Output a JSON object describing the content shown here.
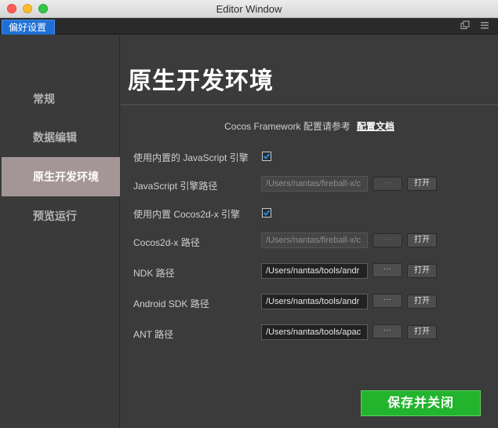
{
  "window": {
    "title": "Editor Window"
  },
  "tab": {
    "label": "偏好设置"
  },
  "sidebar": {
    "items": [
      {
        "label": "常规"
      },
      {
        "label": "数据编辑"
      },
      {
        "label": "原生开发环境"
      },
      {
        "label": "预览运行"
      }
    ]
  },
  "main": {
    "title": "原生开发环境",
    "framework_text": "Cocos Framework 配置请参考",
    "doc_link": "配置文档",
    "js_builtin": {
      "label": "使用内置的 JavaScript 引擎",
      "checked": true
    },
    "js_path": {
      "label": "JavaScript 引擎路径",
      "value": "/Users/nantas/fireball-x/c",
      "dots": "···",
      "open": "打开"
    },
    "cocos_builtin": {
      "label": "使用内置 Cocos2d-x 引擎",
      "checked": true
    },
    "cocos_path": {
      "label": "Cocos2d-x 路径",
      "value": "/Users/nantas/fireball-x/c",
      "dots": "···",
      "open": "打开"
    },
    "ndk_path": {
      "label": "NDK 路径",
      "value": "/Users/nantas/tools/andr",
      "dots": "···",
      "open": "打开"
    },
    "android_sdk_path": {
      "label": "Android SDK 路径",
      "value": "/Users/nantas/tools/andr",
      "dots": "···",
      "open": "打开"
    },
    "ant_path": {
      "label": "ANT 路径",
      "value": "/Users/nantas/tools/apac",
      "dots": "···",
      "open": "打开"
    },
    "save_button": "保存并关闭"
  },
  "colors": {
    "accent_tab": "#1f6fd6",
    "save_green": "#23b42d",
    "active_sidebar": "#a49696",
    "checkbox_blue": "#1e8ae6"
  }
}
